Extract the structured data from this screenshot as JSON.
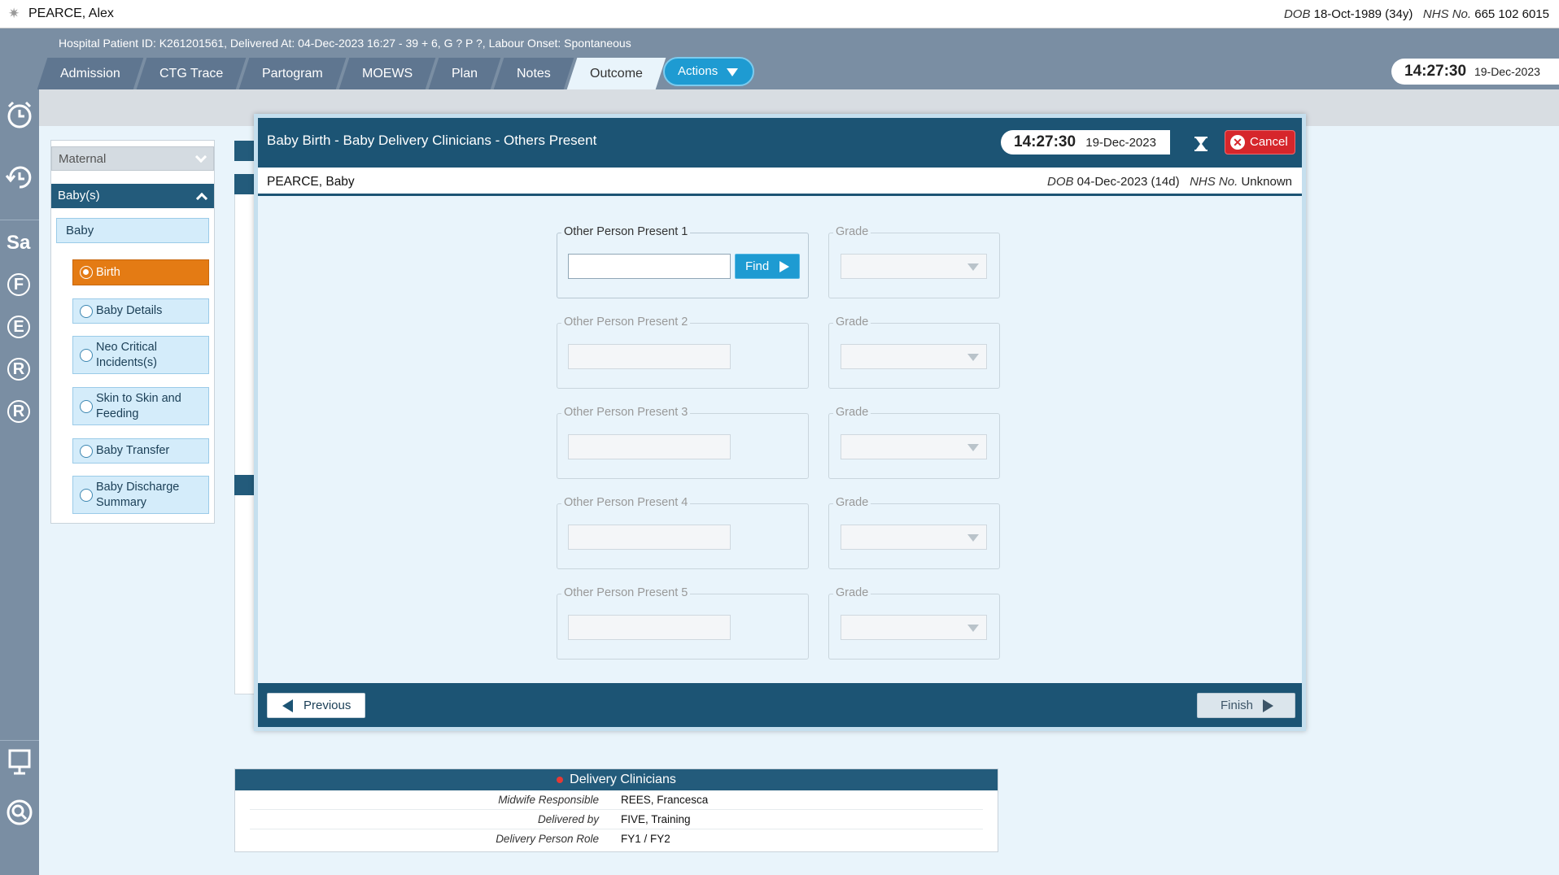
{
  "patient": {
    "name": "PEARCE, Alex",
    "dob_label": "DOB",
    "dob": "18-Oct-1989 (34y)",
    "nhs_label": "NHS No.",
    "nhs": "665 102 6015"
  },
  "hospital_info": "Hospital Patient ID: K261201561, Delivered At: 04-Dec-2023 16:27 - 39 + 6, G ? P ?,   Labour Onset: Spontaneous",
  "tabs": [
    {
      "label": "Admission"
    },
    {
      "label": "CTG Trace"
    },
    {
      "label": "Partogram"
    },
    {
      "label": "MOEWS"
    },
    {
      "label": "Plan"
    },
    {
      "label": "Notes"
    },
    {
      "label": "Outcome"
    }
  ],
  "actions_label": "Actions",
  "clock": {
    "time": "14:27:30",
    "date": "19-Dec-2023"
  },
  "rail": {
    "sa": "Sa",
    "letters": [
      "F",
      "E",
      "R",
      "R"
    ]
  },
  "nav": {
    "maternal": "Maternal",
    "babys": "Baby(s)",
    "baby": "Baby",
    "items": [
      {
        "label": "Birth"
      },
      {
        "label": "Baby Details"
      },
      {
        "label": "Neo Critical Incidents(s)"
      },
      {
        "label": "Skin to Skin and Feeding"
      },
      {
        "label": "Baby Transfer"
      },
      {
        "label": "Baby Discharge Summary"
      }
    ]
  },
  "clinicians": {
    "title": "Delivery Clinicians",
    "rows": [
      {
        "label": "Midwife Responsible",
        "value": "REES, Francesca"
      },
      {
        "label": "Delivered by",
        "value": "FIVE, Training"
      },
      {
        "label": "Delivery Person Role",
        "value": "FY1 / FY2"
      }
    ]
  },
  "modal": {
    "title": "Baby Birth - Baby Delivery Clinicians - Others Present",
    "clock": {
      "time": "14:27:30",
      "date": "19-Dec-2023"
    },
    "cancel_label": "Cancel",
    "baby_name": "PEARCE, Baby",
    "baby_dob_label": "DOB",
    "baby_dob": "04-Dec-2023 (14d)",
    "baby_nhs_label": "NHS No.",
    "baby_nhs": "Unknown",
    "fields": [
      {
        "label": "Other Person Present 1",
        "grade_label": "Grade",
        "value": ""
      },
      {
        "label": "Other Person Present 2",
        "grade_label": "Grade",
        "value": ""
      },
      {
        "label": "Other Person Present 3",
        "grade_label": "Grade",
        "value": ""
      },
      {
        "label": "Other Person Present 4",
        "grade_label": "Grade",
        "value": ""
      },
      {
        "label": "Other Person Present 5",
        "grade_label": "Grade",
        "value": ""
      }
    ],
    "find_label": "Find",
    "previous_label": "Previous",
    "finish_label": "Finish"
  },
  "colors": {
    "header_dark": "#1c5474",
    "rail": "#7a8ea3",
    "active_orange": "#e47b14",
    "accent_blue": "#1e9bd2",
    "cancel_red": "#d6262b"
  }
}
